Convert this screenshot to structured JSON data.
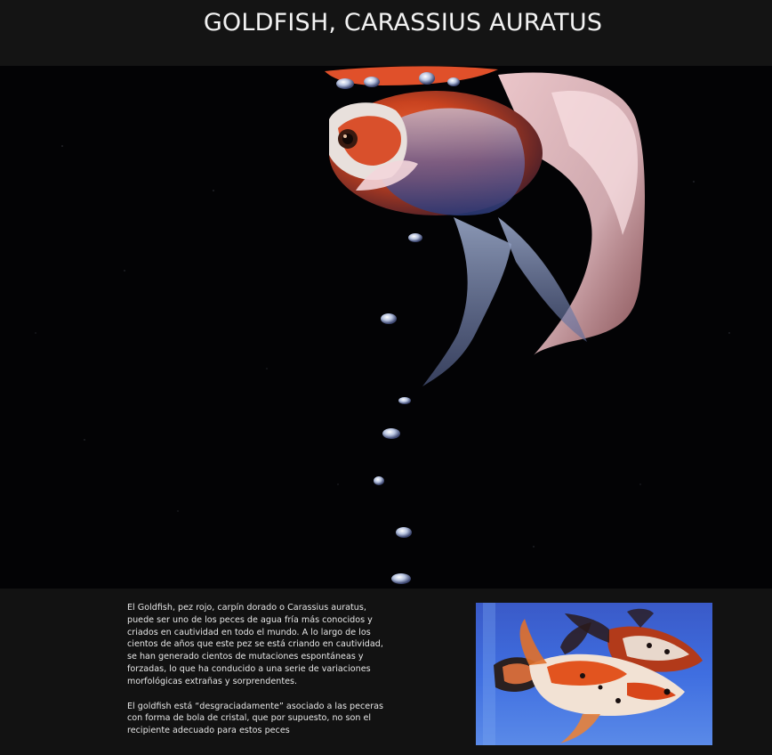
{
  "header": {
    "title": "GOLDFISH, CARASSIUS AURATUS"
  },
  "hero_image": {
    "icon": "goldfish-photo",
    "subject": "goldfish"
  },
  "article": {
    "paragraphs": [
      "El Goldfish, pez rojo, carpín dorado o Carassius auratus, puede ser uno de los peces de agua fría más conocidos y criados en cautividad en todo el mundo. A lo largo de los cientos de años que este pez se está criando en cautividad, se han generado cientos de mutaciones espontáneas y forzadas, lo que ha conducido a una serie de variaciones morfológicas extrañas y sorprendentes.",
      "El goldfish está “desgraciadamente” asociado a las peceras con forma de bola de cristal, que por supuesto, no son el recipiente adecuado para estos peces"
    ]
  },
  "side_image": {
    "icon": "koi-fish-photo",
    "subject": "fish"
  },
  "colors": {
    "header_bg": "#141414",
    "hero_bg": "#030305",
    "content_bg": "#121212",
    "text": "#e6e6e6"
  }
}
